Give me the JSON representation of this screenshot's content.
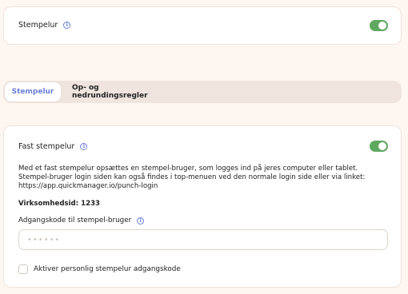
{
  "top_setting": {
    "label": "Stempelur",
    "info_icon": "info-icon",
    "toggle_on": true
  },
  "tabs": [
    {
      "label": "Stempelur",
      "active": true
    },
    {
      "label": "Op- og nedrundingsregler",
      "active": false
    }
  ],
  "main": {
    "fixed_label": "Fast stempelur",
    "fixed_toggle_on": true,
    "description": "Med et fast stempelur opsættes en stempel-bruger, som logges ind på jeres computer eller tablet. Stempel-bruger login siden kan også findes i top-menuen ved den normale login side eller via linket: https://app.quickmanager.io/punch-login",
    "company_id": "Virksomhedsid: 1233",
    "password_label": "Adgangskode til stempel-bruger",
    "password_placeholder": "••••••",
    "checkbox_label": "Aktiver personlig stempelur adgangskode",
    "checkbox_checked": false
  },
  "colors": {
    "accent": "#6a7fd6",
    "toggle": "#5fa860",
    "background": "#fdf6f1"
  }
}
